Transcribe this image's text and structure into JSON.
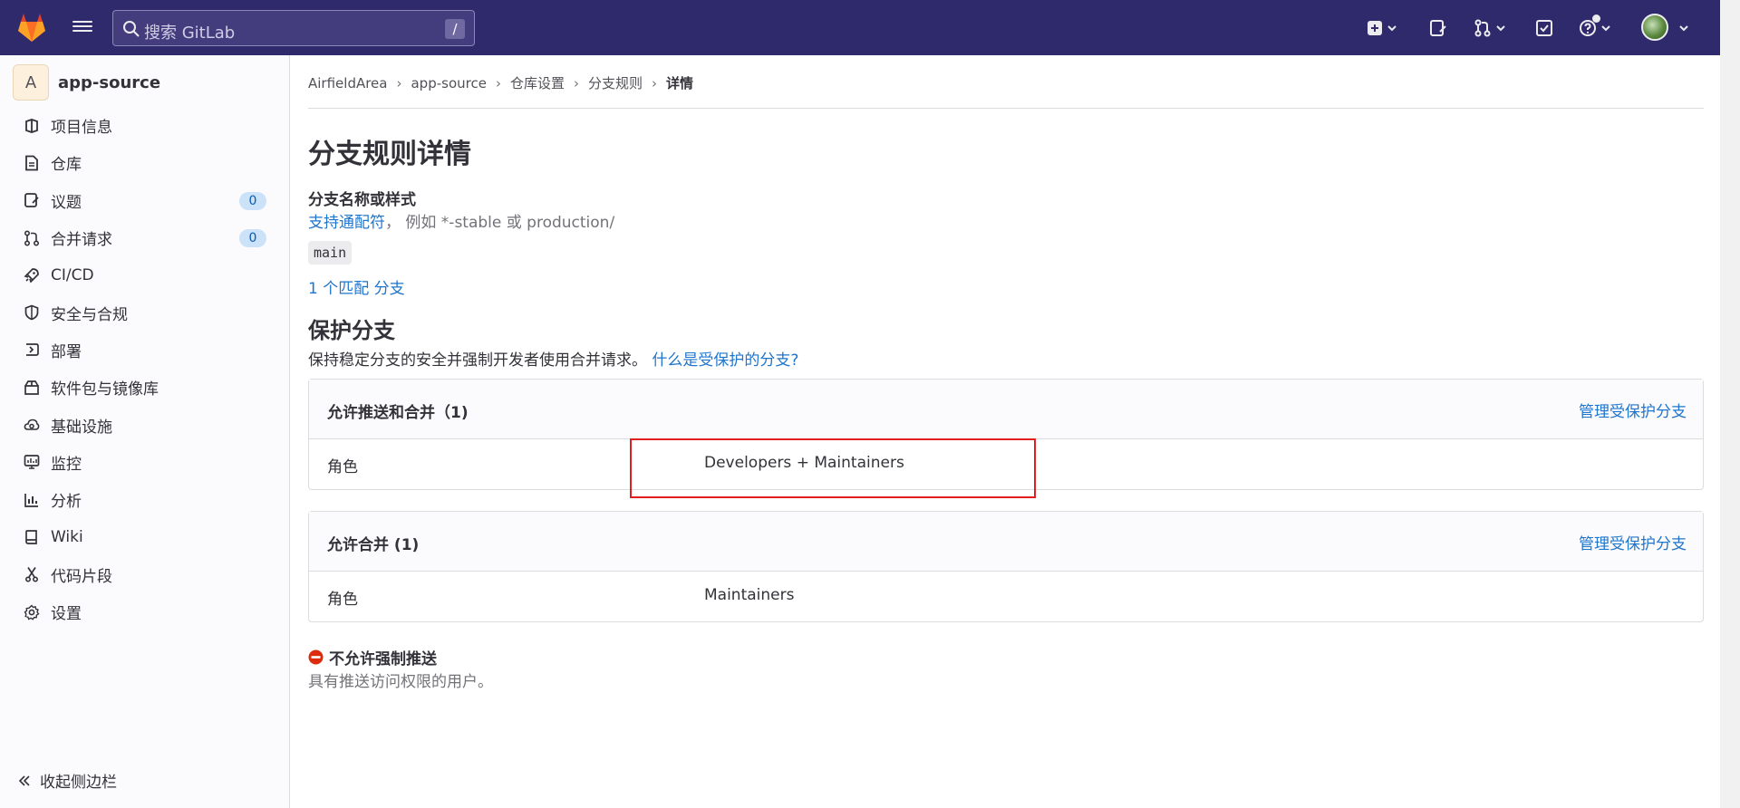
{
  "topbar": {
    "search_placeholder": "搜索 GitLab",
    "search_shortcut": "/",
    "icons": [
      "gitlab-logo",
      "menu-icon",
      "search-icon",
      "new-item-icon",
      "issues-icon",
      "merge-requests-icon",
      "todo-icon",
      "help-icon",
      "user-avatar"
    ]
  },
  "sidebar": {
    "project_initial": "A",
    "project_name": "app-source",
    "items": [
      {
        "label": "项目信息",
        "icon": "project-info-icon"
      },
      {
        "label": "仓库",
        "icon": "repository-icon"
      },
      {
        "label": "议题",
        "icon": "issues-icon",
        "badge": "0"
      },
      {
        "label": "合并请求",
        "icon": "merge-request-icon",
        "badge": "0"
      },
      {
        "label": "CI/CD",
        "icon": "rocket-icon"
      },
      {
        "label": "安全与合规",
        "icon": "shield-icon"
      },
      {
        "label": "部署",
        "icon": "deploy-icon"
      },
      {
        "label": "软件包与镜像库",
        "icon": "package-icon"
      },
      {
        "label": "基础设施",
        "icon": "cloud-icon"
      },
      {
        "label": "监控",
        "icon": "monitor-icon"
      },
      {
        "label": "分析",
        "icon": "chart-icon"
      },
      {
        "label": "Wiki",
        "icon": "book-icon"
      },
      {
        "label": "代码片段",
        "icon": "snippet-icon"
      },
      {
        "label": "设置",
        "icon": "gear-icon"
      }
    ],
    "collapse_label": "收起侧边栏"
  },
  "breadcrumb": {
    "items": [
      "AirfieldArea",
      "app-source",
      "仓库设置",
      "分支规则"
    ],
    "current": "详情"
  },
  "page": {
    "title": "分支规则详情",
    "branch_field_label": "分支名称或样式",
    "wildcard_link": "支持通配符",
    "wildcard_example": "， 例如 *-stable 或 production/",
    "branch_name": "main",
    "match_link": "1 个匹配 分支",
    "protect_title": "保护分支",
    "protect_desc": "保持稳定分支的安全并强制开发者使用合并请求。",
    "protect_help_link": "什么是受保护的分支?"
  },
  "cards": [
    {
      "title": "允许推送和合并（1)",
      "action": "管理受保护分支",
      "key": "角色",
      "value": "Developers + Maintainers"
    },
    {
      "title": "允许合并 (1)",
      "action": "管理受保护分支",
      "key": "角色",
      "value": "Maintainers"
    }
  ],
  "force_push": {
    "title": "不允许强制推送",
    "desc": "具有推送访问权限的用户。"
  },
  "colors": {
    "topbar": "#2f2a6b",
    "link": "#1f75cb",
    "highlight": "#e02020",
    "danger": "#dd2b0e"
  }
}
